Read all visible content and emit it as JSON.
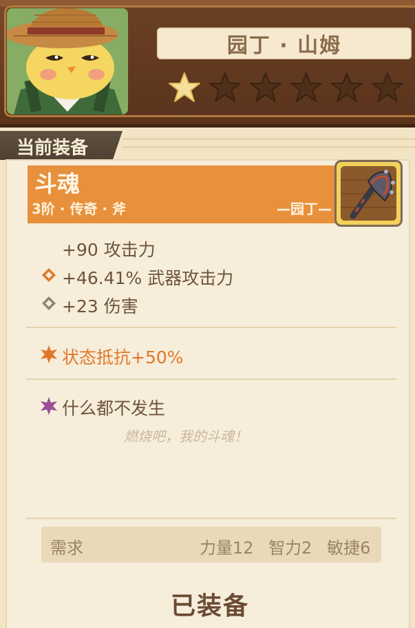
{
  "character": {
    "name": "园丁 · 山姆",
    "stars_filled": 1,
    "stars_total": 6
  },
  "section": {
    "title": "当前装备"
  },
  "item": {
    "name": "斗魂",
    "subtitle": "3阶 · 传奇 · 斧",
    "class_tag": "—园丁—",
    "icon": "axe-icon",
    "base_stats": [
      {
        "icon": "none",
        "text": "+90  攻击力"
      },
      {
        "icon": "orange-diamond-icon",
        "text": "+46.41%  武器攻击力"
      },
      {
        "icon": "gray-diamond-icon",
        "text": "+23  伤害"
      }
    ],
    "special_stat": {
      "icon": "orange-burst-icon",
      "text": "状态抵抗+50%"
    },
    "perk": {
      "icon": "purple-burst-icon",
      "text": "什么都不发生"
    },
    "flavor": "燃烧吧，我的斗魂！"
  },
  "requirements": {
    "label": "需求",
    "values": [
      "力量12",
      "智力2",
      "敏捷6"
    ]
  },
  "button": {
    "label": "已装备"
  },
  "colors": {
    "banner": "#e8913c",
    "accent_orange": "#e0782a",
    "perk_purple": "#9b4e96",
    "parchment": "#f3e4c6",
    "wood": "#6a3e22"
  }
}
